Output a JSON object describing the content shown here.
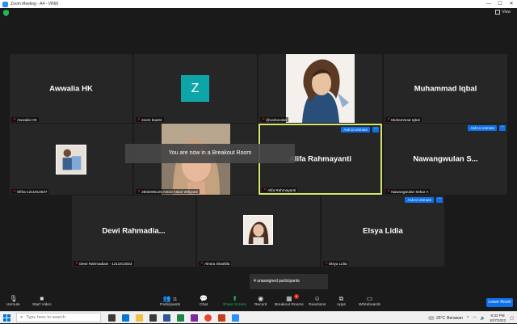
{
  "window": {
    "title": "Zoom Meeting - A4 - VR66",
    "controls": [
      "—",
      "☐",
      "✕"
    ]
  },
  "view_button": {
    "label": "View"
  },
  "tiles": [
    {
      "name": "Awwalia HK",
      "label": "Awwalia HK",
      "display": "name"
    },
    {
      "name": "",
      "label": "zoom baa04",
      "display": "avatar",
      "avatar_letter": "Z",
      "avatar_color": "#0ea5a9"
    },
    {
      "name": "",
      "label": "@carlacosta",
      "display": "portrait"
    },
    {
      "name": "Muhammad Iqbal",
      "label": "Muhammad Iqbal",
      "display": "name"
    },
    {
      "name": "",
      "label": "Elfira-1211913037",
      "display": "photo"
    },
    {
      "name": "",
      "label": "2502065125 Astrid Astari Wiliyanti",
      "display": "video"
    },
    {
      "name": "Alifa Rahmayanti",
      "label": "Alifa Rahmayanti",
      "display": "name",
      "ask": "Ask to Unmute",
      "active": true
    },
    {
      "name": "Nawangwulan S...",
      "label": "Nawangwulan Sekar A",
      "display": "name",
      "ask": "Ask to Unmute"
    },
    {
      "name": "Dewi Rahmadia...",
      "label": "Dewi Rahmadiani - 1211913022",
      "display": "name"
    },
    {
      "name": "",
      "label": "Almira Shathifa",
      "display": "photo"
    },
    {
      "name": "Elsya Lidia",
      "label": "Elsya Lidia",
      "display": "name",
      "ask": "Ask to Unmute"
    }
  ],
  "more_label": "···",
  "breakout_toast": "You are now in a Breakout Room",
  "unassigned": "4 unassigned participants",
  "toolbar": {
    "unmute": "Unmute",
    "start_video": "Start Video",
    "participants": "Participants",
    "participants_count": "11",
    "chat": "Chat",
    "share_screen": "Share Screen",
    "record": "Record",
    "breakout_rooms": "Breakout Rooms",
    "breakout_badge": "4",
    "reactions": "Reactions",
    "apps": "Apps",
    "whiteboards": "Whiteboards",
    "leave": "Leave Room"
  },
  "taskbar": {
    "search_placeholder": "Type here to search",
    "weather_temp": "25°C",
    "weather_text": "Berawan",
    "time": "6:33 PM",
    "date": "10/7/2022"
  },
  "colors": {
    "accent_blue": "#0e71eb",
    "active_border": "#d7e66a",
    "share_green": "#1db954",
    "muted_red": "#e02828"
  }
}
